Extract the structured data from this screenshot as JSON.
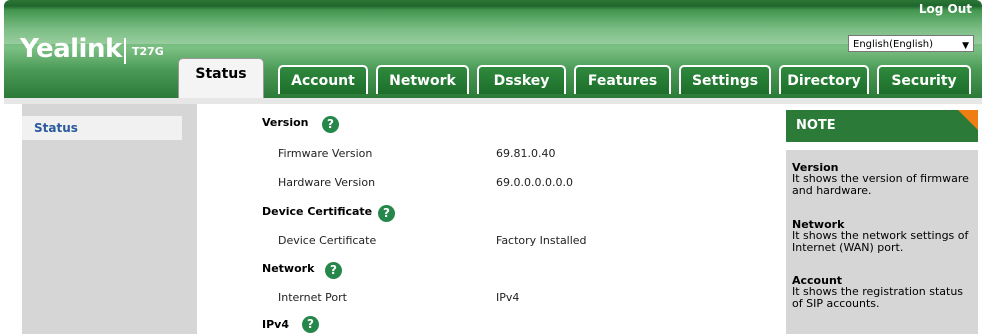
{
  "header": {
    "logo": "Yealink",
    "model": "T27G",
    "logout": "Log Out",
    "language": "English(English)"
  },
  "tabs": [
    {
      "label": "Status",
      "active": true
    },
    {
      "label": "Account"
    },
    {
      "label": "Network"
    },
    {
      "label": "Dsskey"
    },
    {
      "label": "Features"
    },
    {
      "label": "Settings"
    },
    {
      "label": "Directory"
    },
    {
      "label": "Security"
    }
  ],
  "sidebar": {
    "items": [
      {
        "label": "Status"
      }
    ]
  },
  "main": {
    "version": {
      "title": "Version",
      "rows": [
        {
          "label": "Firmware Version",
          "value": "69.81.0.40"
        },
        {
          "label": "Hardware Version",
          "value": "69.0.0.0.0.0.0"
        }
      ]
    },
    "certificate": {
      "title": "Device Certificate",
      "rows": [
        {
          "label": "Device Certificate",
          "value": "Factory Installed"
        }
      ]
    },
    "network": {
      "title": "Network",
      "rows": [
        {
          "label": "Internet Port",
          "value": "IPv4"
        }
      ]
    },
    "ipv4": {
      "title": "IPv4"
    }
  },
  "note": {
    "title": "NOTE",
    "items": [
      {
        "title": "Version",
        "text": "It shows the version of firmware and hardware."
      },
      {
        "title": "Network",
        "text": "It shows the network settings of Internet (WAN) port."
      },
      {
        "title": "Account",
        "text": "It shows the registration status of SIP accounts."
      }
    ]
  },
  "colors": {
    "brand_green": "#2b7a38",
    "accent_orange": "#f07d12",
    "link_blue": "#2a5a9c"
  }
}
